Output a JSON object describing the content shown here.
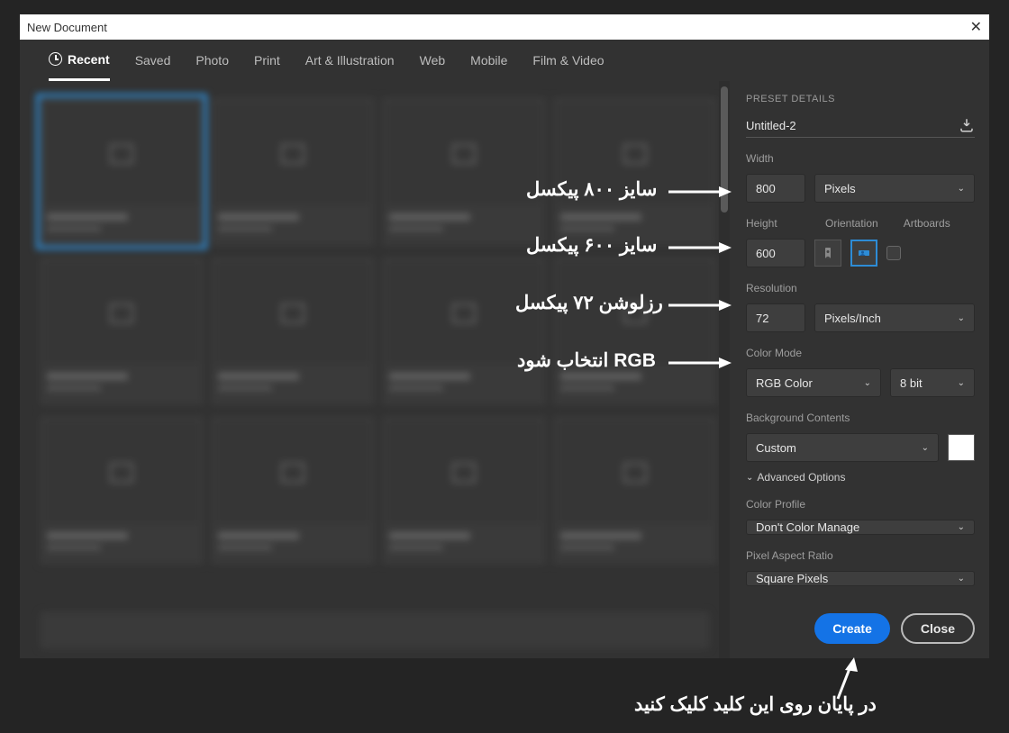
{
  "window": {
    "title": "New Document"
  },
  "tabs": {
    "recent": "Recent",
    "saved": "Saved",
    "photo": "Photo",
    "print": "Print",
    "art": "Art & Illustration",
    "web": "Web",
    "mobile": "Mobile",
    "film": "Film & Video"
  },
  "panel": {
    "section": "PRESET DETAILS",
    "docname": "Untitled-2",
    "width_label": "Width",
    "width": "800",
    "width_unit": "Pixels",
    "height_label": "Height",
    "height": "600",
    "orient_label": "Orientation",
    "artboards_label": "Artboards",
    "res_label": "Resolution",
    "res": "72",
    "res_unit": "Pixels/Inch",
    "mode_label": "Color Mode",
    "mode": "RGB Color",
    "depth": "8 bit",
    "bg_label": "Background Contents",
    "bg": "Custom",
    "adv": "Advanced Options",
    "profile_label": "Color Profile",
    "profile": "Don't Color Manage",
    "aspect_label": "Pixel Aspect Ratio",
    "aspect": "Square Pixels",
    "create": "Create",
    "close": "Close"
  },
  "ann": {
    "width": "سایز ۸۰۰ پیکسل",
    "height": "سایز ۶۰۰ پیکسل",
    "res": "رزلوشن ۷۲ پیکسل",
    "mode": "RGB انتخاب شود",
    "final": "در پایان روی این کلید کلیک کنید"
  }
}
